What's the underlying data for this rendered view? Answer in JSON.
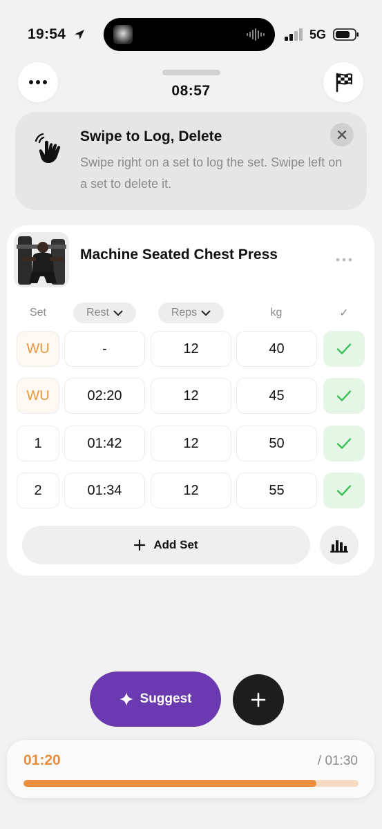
{
  "status_bar": {
    "time": "19:54",
    "network": "5G",
    "icons": [
      "location-arrow-icon",
      "now-playing-thumbnail",
      "audio-waveform-icon",
      "cellular-signal-icon",
      "battery-icon"
    ]
  },
  "header": {
    "elapsed_time": "08:57",
    "more_icon": "ellipsis-icon",
    "finish_icon": "checkered-flag-icon"
  },
  "tip": {
    "title": "Swipe to Log, Delete",
    "body": "Swipe right on a set to log the set. Swipe left on a set to delete it.",
    "icon": "swipe-hand-icon",
    "close_icon": "close-icon"
  },
  "exercise": {
    "name": "Machine Seated Chest Press",
    "columns": {
      "set": "Set",
      "rest": "Rest",
      "reps": "Reps",
      "weight": "kg",
      "done": "✓"
    },
    "sets": [
      {
        "set": "WU",
        "rest": "-",
        "reps": "12",
        "weight": "40",
        "done": true,
        "warmup": true
      },
      {
        "set": "WU",
        "rest": "02:20",
        "reps": "12",
        "weight": "45",
        "done": true,
        "warmup": true
      },
      {
        "set": "1",
        "rest": "01:42",
        "reps": "12",
        "weight": "50",
        "done": true,
        "warmup": false
      },
      {
        "set": "2",
        "rest": "01:34",
        "reps": "12",
        "weight": "55",
        "done": true,
        "warmup": false
      }
    ],
    "add_set_label": "Add Set",
    "stats_icon": "bar-chart-icon"
  },
  "actions": {
    "suggest_label": "Suggest",
    "suggest_icon": "sparkle-icon",
    "add_icon": "plus-icon"
  },
  "rest_timer": {
    "current": "01:20",
    "total": "/ 01:30",
    "progress": 0.875
  },
  "colors": {
    "accent_orange": "#ea8d3a",
    "suggest_purple": "#6b3ab0",
    "check_green": "#3cc05a",
    "check_bg": "#e6f6e6"
  }
}
